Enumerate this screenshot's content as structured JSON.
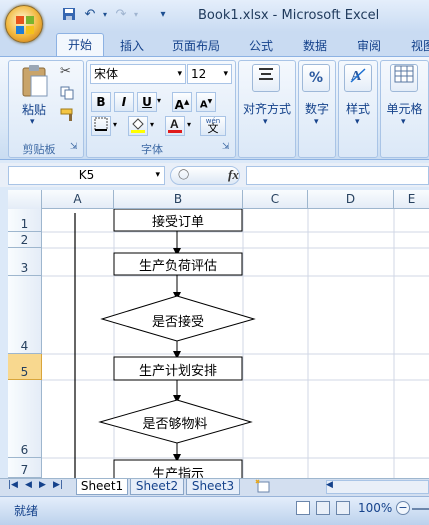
{
  "window": {
    "title": "Book1.xlsx - Microsoft Excel"
  },
  "quick_access": {
    "save_icon": "save-icon",
    "undo_icon": "undo-icon",
    "redo_icon": "redo-icon",
    "customize_icon": "chevron-down-icon"
  },
  "tabs": [
    "开始",
    "插入",
    "页面布局",
    "公式",
    "数据",
    "审阅",
    "视图"
  ],
  "active_tab": "开始",
  "ribbon": {
    "clipboard": {
      "paste_label": "粘贴",
      "group_label": "剪贴板"
    },
    "font": {
      "font_name": "宋体",
      "font_size": "12",
      "bold": "B",
      "italic": "I",
      "underline": "U",
      "grow": "A",
      "shrink": "A",
      "group_label": "字体",
      "wen": "wén",
      "wen_char": "文"
    },
    "alignment_label": "对齐方式",
    "number_label": "数字",
    "number_symbol": "%",
    "styles_label": "样式",
    "cells_label": "单元格"
  },
  "formula_bar": {
    "name_box": "K5",
    "fx": "fx"
  },
  "columns": [
    "A",
    "B",
    "C",
    "D",
    "E"
  ],
  "rows": [
    "1",
    "2",
    "3",
    "4",
    "5",
    "6",
    "7"
  ],
  "selected_row": "5",
  "flowchart": {
    "step1": "接受订单",
    "step2": "生产负荷评估",
    "decision1": "是否接受",
    "step3": "生产计划安排",
    "decision2": "是否够物料",
    "step4": "生产指示"
  },
  "sheets": [
    "Sheet1",
    "Sheet2",
    "Sheet3"
  ],
  "active_sheet": "Sheet1",
  "status": {
    "ready": "就绪",
    "zoom": "100%"
  },
  "colors": {
    "ribbon_blue": "#dce9f8",
    "selected_row": "#f8d88f"
  }
}
